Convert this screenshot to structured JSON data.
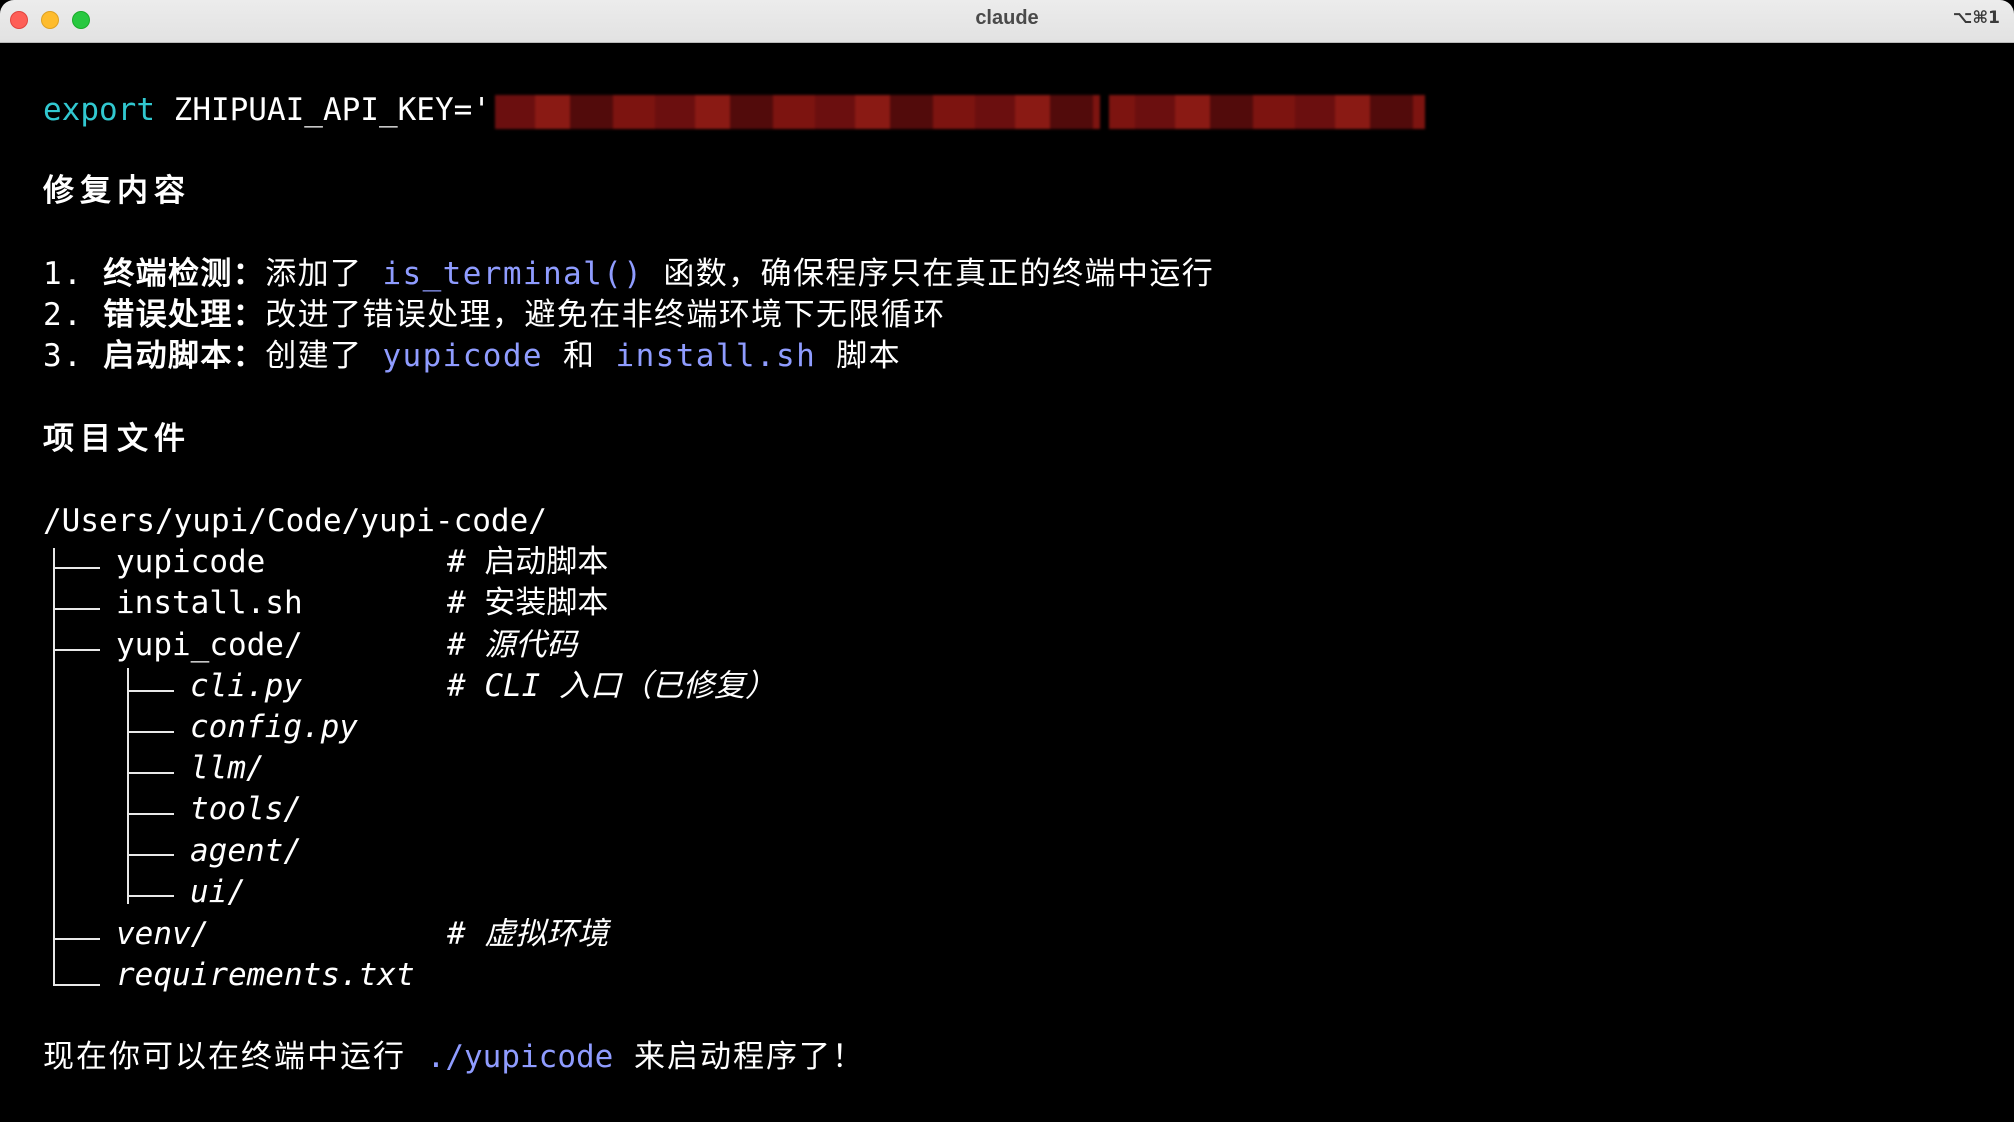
{
  "window": {
    "title": "claude",
    "shortcut": "⌥⌘1"
  },
  "export_line": {
    "keyword": "export",
    "var": "ZHIPUAI_API_KEY='"
  },
  "fix_section": {
    "heading": "修复内容",
    "items": [
      {
        "num": "1. ",
        "label": "终端检测：",
        "pre": "添加了 ",
        "code": "is_terminal()",
        "post": " 函数，确保程序只在真正的终端中运行"
      },
      {
        "num": "2. ",
        "label": "错误处理：",
        "pre": "改进了错误处理，避免在非终端环境下无限循环"
      },
      {
        "num": "3. ",
        "label": "启动脚本：",
        "pre": "创建了 ",
        "code": "yupicode",
        "mid": " 和 ",
        "code2": "install.sh",
        "post": " 脚本"
      }
    ]
  },
  "files_section": {
    "heading": "项目文件",
    "root": "/Users/yupi/Code/yupi-code/",
    "entries": [
      {
        "name": "yupicode",
        "comment": "# 启动脚本"
      },
      {
        "name": "install.sh",
        "comment": "# 安装脚本"
      },
      {
        "name": "yupi_code/",
        "comment": "# 源代码"
      },
      {
        "name": "cli.py",
        "comment": "# CLI 入口（已修复）"
      },
      {
        "name": "config.py",
        "comment": ""
      },
      {
        "name": "llm/",
        "comment": ""
      },
      {
        "name": "tools/",
        "comment": ""
      },
      {
        "name": "agent/",
        "comment": ""
      },
      {
        "name": "ui/",
        "comment": ""
      },
      {
        "name": "venv/",
        "comment": "# 虚拟环境"
      },
      {
        "name": "requirements.txt",
        "comment": ""
      }
    ]
  },
  "footer": {
    "pre": "现在你可以在终端中运行 ",
    "cmd": "./yupicode",
    "post": " 来启动程序了！"
  },
  "colors": {
    "keyword": "#31c8d0",
    "code": "#8f9cff",
    "text": "#ffffff",
    "background": "#000000"
  }
}
